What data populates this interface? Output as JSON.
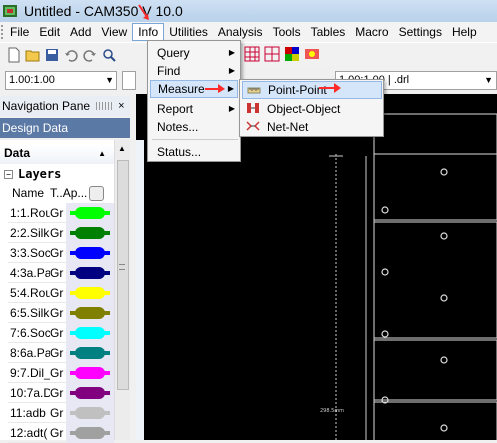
{
  "window": {
    "title": "Untitled - CAM350 V 10.0"
  },
  "menubar": {
    "items": [
      {
        "label": "File",
        "active": false
      },
      {
        "label": "Edit",
        "active": false
      },
      {
        "label": "Add",
        "active": false
      },
      {
        "label": "View",
        "active": false
      },
      {
        "label": "Info",
        "active": true
      },
      {
        "label": "Utilities",
        "active": false
      },
      {
        "label": "Analysis",
        "active": false
      },
      {
        "label": "Tools",
        "active": false
      },
      {
        "label": "Tables",
        "active": false
      },
      {
        "label": "Macro",
        "active": false
      },
      {
        "label": "Settings",
        "active": false
      },
      {
        "label": "Help",
        "active": false
      }
    ]
  },
  "toolbar2": {
    "scale_value": "1.00:1.00",
    "file_value": "1.00:1.00 | .drl"
  },
  "nav": {
    "pane_title": "Navigation Pane",
    "close_label": "×",
    "design_data_title": "Design Data"
  },
  "panel": {
    "data_header": "Data",
    "layers_label": "Layers",
    "col_name": "Name",
    "col_t": "T..",
    "col_ap": "Ap...",
    "layers": [
      {
        "name": "1:1.Rou",
        "type": "Gr",
        "color": "#00ff00"
      },
      {
        "name": "2:2.Silk",
        "type": "Gr",
        "color": "#008000"
      },
      {
        "name": "3:3.Soc",
        "type": "Gr",
        "color": "#0000ff"
      },
      {
        "name": "4:3a.Pa",
        "type": "Gr",
        "color": "#000080"
      },
      {
        "name": "5:4.Rou",
        "type": "Gr",
        "color": "#ffff00"
      },
      {
        "name": "6:5.Silk",
        "type": "Gr",
        "color": "#808000"
      },
      {
        "name": "7:6.Soc",
        "type": "Gr",
        "color": "#00ffff"
      },
      {
        "name": "8:6a.Pa",
        "type": "Gr",
        "color": "#008080"
      },
      {
        "name": "9:7.Dil_",
        "type": "Gr",
        "color": "#ff00ff"
      },
      {
        "name": "10:7a.D",
        "type": "Gr",
        "color": "#800080"
      },
      {
        "name": "11:adb",
        "type": "Gr",
        "color": "#c0c0c0"
      },
      {
        "name": "12:adt(",
        "type": "Gr",
        "color": "#a0a0a0"
      }
    ]
  },
  "info_menu": {
    "items": [
      {
        "label": "Query",
        "has_sub": true
      },
      {
        "label": "Find",
        "has_sub": true
      },
      {
        "label": "Measure",
        "has_sub": true,
        "highlighted": true
      },
      {
        "label": "Report",
        "has_sub": true
      },
      {
        "label": "Notes...",
        "has_sub": false
      },
      {
        "label": "Status...",
        "has_sub": false
      }
    ]
  },
  "measure_submenu": {
    "items": [
      {
        "label": "Point-Point",
        "icon": "ruler-icon",
        "highlighted": true
      },
      {
        "label": "Object-Object",
        "icon": "object-measure-icon"
      },
      {
        "label": "Net-Net",
        "icon": "net-measure-icon"
      }
    ]
  },
  "canvas": {
    "dimension_label": "298.5mm"
  },
  "colors": {
    "highlight": "#d5e6fa",
    "design_data_bar": "#5b79a5",
    "canvas_bg": "#000000",
    "arrow": "#ff2a2a"
  }
}
